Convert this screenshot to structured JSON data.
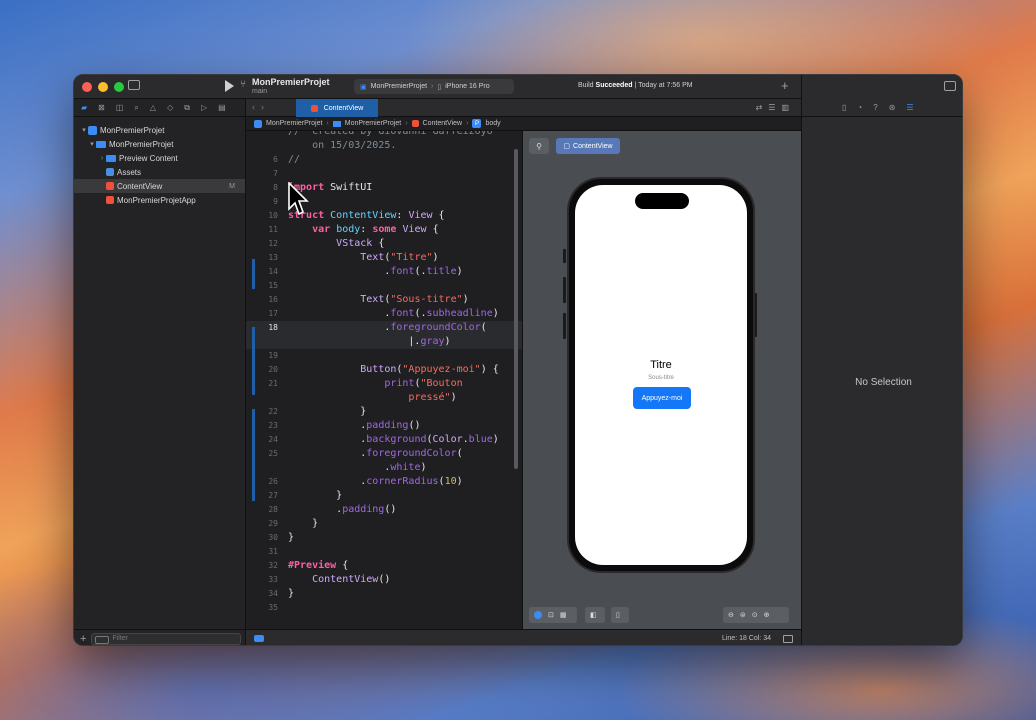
{
  "window": {
    "project_name": "MonPremierProjet",
    "branch": "main",
    "scheme": "MonPremierProjet",
    "device": "iPhone 16 Pro",
    "build_status_prefix": "Build",
    "build_status_bold": "Succeeded",
    "build_status_time": "| Today at 7:56 PM"
  },
  "navigator": {
    "items": [
      {
        "label": "MonPremierProjet",
        "type": "project",
        "indent": 0,
        "chevron": "▾"
      },
      {
        "label": "MonPremierProjet",
        "type": "folder",
        "indent": 1,
        "chevron": "▾"
      },
      {
        "label": "Preview Content",
        "type": "folder",
        "indent": 2,
        "chevron": "›"
      },
      {
        "label": "Assets",
        "type": "assets",
        "indent": 2,
        "chevron": ""
      },
      {
        "label": "ContentView",
        "type": "swift",
        "indent": 2,
        "chevron": "",
        "badge": "M",
        "selected": true
      },
      {
        "label": "MonPremierProjetApp",
        "type": "swift",
        "indent": 2,
        "chevron": ""
      }
    ],
    "filter_placeholder": "Filter"
  },
  "editor": {
    "tab_label": "ContentView",
    "breadcrumb": [
      "MonPremierProjet",
      "MonPremierProjet",
      "ContentView",
      "body"
    ],
    "status_position": "Line: 18  Col: 34"
  },
  "code_lines": [
    {
      "n": "",
      "html": "<span class=\"cm\">//  Created by Giovanni Gaffeizoyo</span>"
    },
    {
      "n": "",
      "html": "<span class=\"cm\">    on 15/03/2025.</span>"
    },
    {
      "n": "6",
      "html": "<span class=\"cm\">//</span>"
    },
    {
      "n": "7",
      "html": ""
    },
    {
      "n": "8",
      "html": "<span class=\"kw\">import</span> SwiftUI"
    },
    {
      "n": "9",
      "html": ""
    },
    {
      "n": "10",
      "html": "<span class=\"kw\">struct</span> <span class=\"ty\">ContentView</span>: <span class=\"cls\">View</span> {"
    },
    {
      "n": "11",
      "html": "    <span class=\"kw\">var</span> <span class=\"ty\">body</span>: <span class=\"kw\">some</span> <span class=\"cls\">View</span> {"
    },
    {
      "n": "12",
      "html": "        <span class=\"cls\">VStack</span> {"
    },
    {
      "n": "13",
      "html": "            <span class=\"cls\">Text</span>(<span class=\"str\">\"Titre\"</span>)"
    },
    {
      "n": "14",
      "html": "                .<span class=\"mth\">font</span>(.<span class=\"mth\">title</span>)"
    },
    {
      "n": "15",
      "html": ""
    },
    {
      "n": "16",
      "html": "            <span class=\"cls\">Text</span>(<span class=\"str\">\"Sous-titre\"</span>)"
    },
    {
      "n": "17",
      "html": "                .<span class=\"mth\">font</span>(.<span class=\"mth\">subheadline</span>)"
    },
    {
      "n": "18",
      "html": "                .<span class=\"mth\">foregroundColor</span>(",
      "current": true
    },
    {
      "n": "",
      "html": "                    |.<span class=\"mth\">gray</span>)",
      "current": true
    },
    {
      "n": "19",
      "html": ""
    },
    {
      "n": "20",
      "html": "            <span class=\"cls\">Button</span>(<span class=\"str\">\"Appuyez-moi\"</span>) {"
    },
    {
      "n": "21",
      "html": "                <span class=\"mth\">print</span>(<span class=\"str\">\"Bouton</span>"
    },
    {
      "n": "",
      "html": "                    <span class=\"str\">pressé\"</span>)"
    },
    {
      "n": "22",
      "html": "            }"
    },
    {
      "n": "23",
      "html": "            .<span class=\"mth\">padding</span>()"
    },
    {
      "n": "24",
      "html": "            .<span class=\"mth\">background</span>(<span class=\"cls\">Color</span>.<span class=\"mth\">blue</span>)"
    },
    {
      "n": "25",
      "html": "            .<span class=\"mth\">foregroundColor</span>("
    },
    {
      "n": "",
      "html": "                .<span class=\"mth\">white</span>)"
    },
    {
      "n": "26",
      "html": "            .<span class=\"mth\">cornerRadius</span>(<span class=\"num\">10</span>)"
    },
    {
      "n": "27",
      "html": "        }"
    },
    {
      "n": "28",
      "html": "        .<span class=\"mth\">padding</span>()"
    },
    {
      "n": "29",
      "html": "    }"
    },
    {
      "n": "30",
      "html": "}"
    },
    {
      "n": "31",
      "html": ""
    },
    {
      "n": "32",
      "html": "<span class=\"kw\">#Preview</span> {"
    },
    {
      "n": "33",
      "html": "    <span class=\"cls\">ContentView</span>()"
    },
    {
      "n": "34",
      "html": "}"
    },
    {
      "n": "35",
      "html": ""
    }
  ],
  "canvas": {
    "chip_label": "ContentView",
    "preview_title": "Titre",
    "preview_subtitle": "Sous-titre",
    "preview_button": "Appuyez-moi"
  },
  "inspector": {
    "empty_label": "No Selection"
  },
  "colors": {
    "accent": "#3b8cf5",
    "swift_orange": "#f05138",
    "ios_button": "#1477f8"
  }
}
